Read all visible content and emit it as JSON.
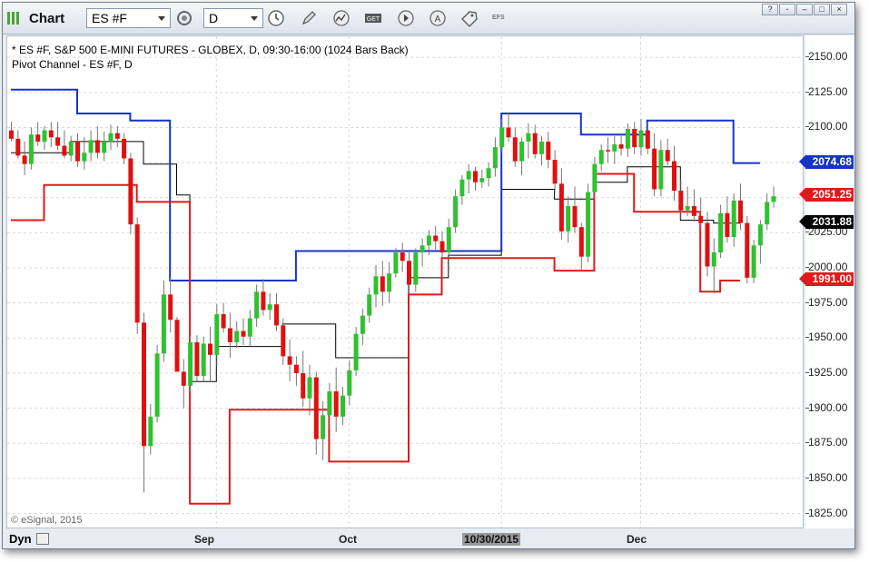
{
  "window": {
    "title": "Chart",
    "symbol_value": "ES #F",
    "interval_value": "D",
    "efs_label": "EFS",
    "controls": [
      "?",
      "-",
      "–",
      "□",
      "×"
    ]
  },
  "chart_info": {
    "line1": "* ES #F, S&P 500 E-MINI FUTURES - GLOBEX, D, 09:30-16:00 (1024 Bars Back)",
    "line2": "Pivot Channel - ES #F, D",
    "copyright": "© eSignal, 2015"
  },
  "y_axis": {
    "labels": [
      "2150.00",
      "2125.00",
      "2100.00",
      "2075.00",
      "2050.00",
      "2025.00",
      "2000.00",
      "1975.00",
      "1950.00",
      "1925.00",
      "1900.00",
      "1875.00",
      "1850.00",
      "1825.00"
    ],
    "badges": [
      {
        "text": "2074.68",
        "color": "#1533c9"
      },
      {
        "text": "2051.25",
        "color": "#e01a1a"
      },
      {
        "text": "2031.88",
        "color": "#000000"
      },
      {
        "text": "1991.00",
        "color": "#e01a1a"
      }
    ]
  },
  "x_axis": {
    "dyn_label": "Dyn",
    "labels": [
      "Sep",
      "Oct",
      "10/30/2015",
      "Dec"
    ]
  },
  "chart_data": {
    "type": "candlestick",
    "title": "* ES #F, S&P 500 E-MINI FUTURES - GLOBEX, D, 09:30-16:00 (1024 Bars Back)",
    "ylim": [
      1815,
      2165
    ],
    "y_ticks": [
      2150,
      2125,
      2100,
      2075,
      2050,
      2025,
      2000,
      1975,
      1950,
      1925,
      1900,
      1875,
      1850,
      1825
    ],
    "x_ticks": [
      "Sep",
      "Oct",
      "10/30/2015",
      "Dec"
    ],
    "colors": {
      "up": "#2fc12f",
      "down": "#e01010",
      "upper": "#1533c9",
      "lower": "#e01a1a",
      "mid": "#000000"
    },
    "candles": [
      [
        2098,
        2104,
        2090,
        2092
      ],
      [
        2092,
        2098,
        2078,
        2080
      ],
      [
        2080,
        2090,
        2066,
        2074
      ],
      [
        2074,
        2100,
        2070,
        2095
      ],
      [
        2095,
        2104,
        2087,
        2090
      ],
      [
        2090,
        2101,
        2084,
        2098
      ],
      [
        2098,
        2104,
        2086,
        2093
      ],
      [
        2093,
        2104,
        2084,
        2087
      ],
      [
        2087,
        2098,
        2078,
        2080
      ],
      [
        2080,
        2094,
        2076,
        2090
      ],
      [
        2090,
        2096,
        2072,
        2076
      ],
      [
        2076,
        2093,
        2070,
        2082
      ],
      [
        2082,
        2098,
        2076,
        2091
      ],
      [
        2091,
        2101,
        2078,
        2082
      ],
      [
        2082,
        2097,
        2076,
        2090
      ],
      [
        2090,
        2102,
        2084,
        2096
      ],
      [
        2096,
        2101,
        2086,
        2092
      ],
      [
        2092,
        2096,
        2074,
        2078
      ],
      [
        2078,
        2082,
        2024,
        2031
      ],
      [
        2031,
        2036,
        1953,
        1961
      ],
      [
        1961,
        1968,
        1840,
        1873
      ],
      [
        1873,
        1903,
        1867,
        1894
      ],
      [
        1894,
        1945,
        1890,
        1939
      ],
      [
        1939,
        1991,
        1933,
        1981
      ],
      [
        1981,
        1993,
        1954,
        1963
      ],
      [
        1963,
        1965,
        1932,
        1926
      ],
      [
        1926,
        1935,
        1900,
        1916
      ],
      [
        1916,
        1952,
        1911,
        1947
      ],
      [
        1947,
        1952,
        1919,
        1923
      ],
      [
        1923,
        1951,
        1919,
        1946
      ],
      [
        1946,
        1958,
        1919,
        1938
      ],
      [
        1938,
        1974,
        1930,
        1967
      ],
      [
        1967,
        1975,
        1954,
        1957
      ],
      [
        1957,
        1968,
        1936,
        1947
      ],
      [
        1947,
        1962,
        1943,
        1955
      ],
      [
        1955,
        1964,
        1945,
        1951
      ],
      [
        1951,
        1970,
        1944,
        1964
      ],
      [
        1964,
        1988,
        1958,
        1983
      ],
      [
        1983,
        1992,
        1966,
        1970
      ],
      [
        1970,
        1982,
        1963,
        1974
      ],
      [
        1974,
        1982,
        1955,
        1959
      ],
      [
        1959,
        1964,
        1931,
        1937
      ],
      [
        1937,
        1949,
        1919,
        1931
      ],
      [
        1931,
        1937,
        1916,
        1925
      ],
      [
        1925,
        1941,
        1901,
        1907
      ],
      [
        1907,
        1931,
        1895,
        1922
      ],
      [
        1922,
        1926,
        1867,
        1878
      ],
      [
        1878,
        1905,
        1863,
        1895
      ],
      [
        1895,
        1918,
        1885,
        1912
      ],
      [
        1912,
        1929,
        1883,
        1894
      ],
      [
        1894,
        1915,
        1888,
        1909
      ],
      [
        1909,
        1934,
        1902,
        1927
      ],
      [
        1927,
        1958,
        1923,
        1953
      ],
      [
        1953,
        1971,
        1945,
        1966
      ],
      [
        1966,
        1986,
        1961,
        1981
      ],
      [
        1981,
        2002,
        1972,
        1994
      ],
      [
        1994,
        2005,
        1973,
        1983
      ],
      [
        1983,
        2004,
        1975,
        1996
      ],
      [
        1996,
        2014,
        1993,
        2011
      ],
      [
        2011,
        2018,
        1997,
        2005
      ],
      [
        2005,
        2013,
        1982,
        1988
      ],
      [
        1988,
        2014,
        1983,
        2011
      ],
      [
        2011,
        2021,
        2001,
        2016
      ],
      [
        2016,
        2027,
        2009,
        2023
      ],
      [
        2023,
        2030,
        2012,
        2019
      ],
      [
        2019,
        2026,
        2007,
        2011
      ],
      [
        2011,
        2035,
        2007,
        2029
      ],
      [
        2029,
        2056,
        2025,
        2051
      ],
      [
        2051,
        2066,
        2045,
        2063
      ],
      [
        2063,
        2074,
        2053,
        2069
      ],
      [
        2069,
        2072,
        2055,
        2061
      ],
      [
        2061,
        2070,
        2057,
        2064
      ],
      [
        2064,
        2075,
        2058,
        2071
      ],
      [
        2071,
        2093,
        2065,
        2086
      ],
      [
        2086,
        2106,
        2082,
        2100
      ],
      [
        2100,
        2111,
        2090,
        2093
      ],
      [
        2093,
        2100,
        2072,
        2076
      ],
      [
        2076,
        2093,
        2066,
        2090
      ],
      [
        2090,
        2103,
        2078,
        2096
      ],
      [
        2096,
        2102,
        2078,
        2081
      ],
      [
        2081,
        2094,
        2073,
        2090
      ],
      [
        2090,
        2097,
        2071,
        2077
      ],
      [
        2077,
        2084,
        2054,
        2060
      ],
      [
        2060,
        2071,
        2020,
        2026
      ],
      [
        2026,
        2051,
        2018,
        2044
      ],
      [
        2044,
        2058,
        2025,
        2029
      ],
      [
        2029,
        2032,
        1998,
        2008
      ],
      [
        2008,
        2060,
        2004,
        2054
      ],
      [
        2054,
        2079,
        2050,
        2074
      ],
      [
        2074,
        2088,
        2069,
        2084
      ],
      [
        2084,
        2093,
        2075,
        2083
      ],
      [
        2083,
        2094,
        2074,
        2088
      ],
      [
        2088,
        2096,
        2080,
        2085
      ],
      [
        2085,
        2103,
        2079,
        2099
      ],
      [
        2099,
        2104,
        2081,
        2086
      ],
      [
        2086,
        2106,
        2080,
        2098
      ],
      [
        2098,
        2104,
        2081,
        2085
      ],
      [
        2085,
        2096,
        2051,
        2056
      ],
      [
        2056,
        2091,
        2051,
        2084
      ],
      [
        2084,
        2092,
        2073,
        2076
      ],
      [
        2076,
        2087,
        2048,
        2055
      ],
      [
        2055,
        2063,
        2035,
        2041
      ],
      [
        2041,
        2058,
        2037,
        2044
      ],
      [
        2044,
        2056,
        2033,
        2037
      ],
      [
        2037,
        2050,
        2028,
        2032
      ],
      [
        2032,
        2040,
        1994,
        2001
      ],
      [
        2001,
        2021,
        1982,
        2011
      ],
      [
        2011,
        2045,
        2007,
        2039
      ],
      [
        2039,
        2051,
        2018,
        2022
      ],
      [
        2022,
        2053,
        2015,
        2048
      ],
      [
        2048,
        2060,
        2027,
        2032
      ],
      [
        2032,
        2037,
        1989,
        1993
      ],
      [
        1993,
        2020,
        1989,
        2016
      ],
      [
        2016,
        2034,
        2003,
        2031
      ],
      [
        2031,
        2053,
        2027,
        2047
      ],
      [
        2047,
        2058,
        2043,
        2051
      ]
    ],
    "upper_channel": [
      [
        0,
        2127
      ],
      [
        10,
        2127
      ],
      [
        10,
        2110
      ],
      [
        18,
        2110
      ],
      [
        18,
        2105
      ],
      [
        24,
        2105
      ],
      [
        24,
        1991
      ],
      [
        43,
        1991
      ],
      [
        43,
        2012
      ],
      [
        74,
        2012
      ],
      [
        74,
        2110
      ],
      [
        86,
        2110
      ],
      [
        86,
        2095
      ],
      [
        96,
        2095
      ],
      [
        96,
        2105
      ],
      [
        109,
        2105
      ],
      [
        109,
        2074.68
      ],
      [
        113,
        2074.68
      ]
    ],
    "lower_channel": [
      [
        0,
        2034
      ],
      [
        5,
        2034
      ],
      [
        5,
        2059
      ],
      [
        19,
        2059
      ],
      [
        19,
        2047
      ],
      [
        27,
        2047
      ],
      [
        27,
        1832
      ],
      [
        33,
        1832
      ],
      [
        33,
        1899
      ],
      [
        48,
        1899
      ],
      [
        48,
        1862
      ],
      [
        60,
        1862
      ],
      [
        60,
        1981
      ],
      [
        65,
        1981
      ],
      [
        65,
        2007
      ],
      [
        82,
        2007
      ],
      [
        82,
        1998
      ],
      [
        88,
        1998
      ],
      [
        88,
        2067
      ],
      [
        94,
        2067
      ],
      [
        94,
        2040
      ],
      [
        104,
        2040
      ],
      [
        104,
        1983
      ],
      [
        107,
        1983
      ],
      [
        107,
        1991
      ],
      [
        110,
        1991
      ]
    ],
    "mid_channel": [
      [
        0,
        2082
      ],
      [
        9,
        2082
      ],
      [
        9,
        2090
      ],
      [
        20,
        2090
      ],
      [
        20,
        2074
      ],
      [
        25,
        2074
      ],
      [
        25,
        2052
      ],
      [
        27,
        2052
      ],
      [
        27,
        1919
      ],
      [
        31,
        1919
      ],
      [
        31,
        1944
      ],
      [
        41,
        1944
      ],
      [
        41,
        1960
      ],
      [
        49,
        1960
      ],
      [
        49,
        1936
      ],
      [
        60,
        1936
      ],
      [
        60,
        1993
      ],
      [
        66,
        1993
      ],
      [
        66,
        2009
      ],
      [
        74,
        2009
      ],
      [
        74,
        2056
      ],
      [
        82,
        2056
      ],
      [
        82,
        2049
      ],
      [
        88,
        2049
      ],
      [
        88,
        2061
      ],
      [
        93,
        2061
      ],
      [
        93,
        2072
      ],
      [
        101,
        2072
      ],
      [
        101,
        2034
      ],
      [
        106,
        2034
      ],
      [
        106,
        2031.88
      ],
      [
        110,
        2031.88
      ]
    ]
  }
}
